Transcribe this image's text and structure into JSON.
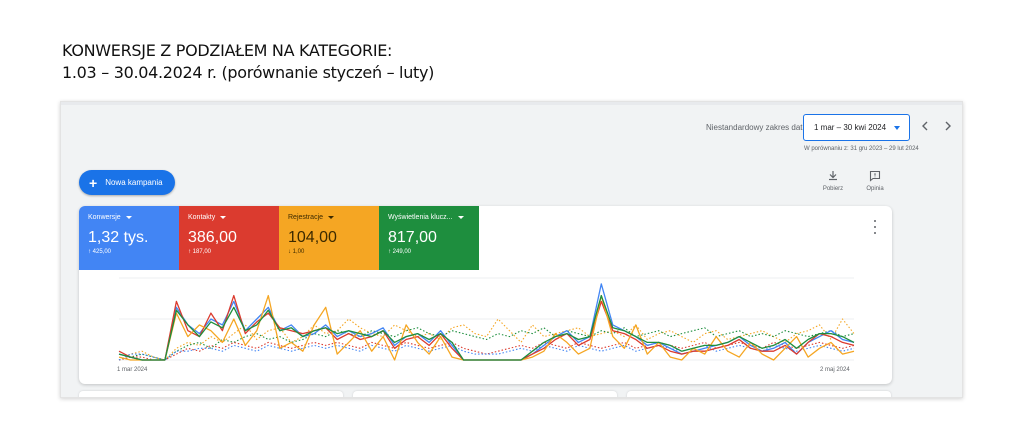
{
  "heading": {
    "line1": "KONWERSJE Z PODZIAŁEM NA KATEGORIE:",
    "line2": "1.03 – 30.04.2024 r. (porównanie styczeń – luty)"
  },
  "date_range": {
    "label": "Niestandardowy zakres dat",
    "value": "1 mar – 30 kwi 2024",
    "comparison": "W porównaniu z: 31 gru 2023 – 29 lut 2024",
    "prev_icon": "chevron-left-icon",
    "next_icon": "chevron-right-icon"
  },
  "toolbar": {
    "new_campaign": "Nowa kampania",
    "download": "Pobierz",
    "feedback": "Opinia"
  },
  "metrics": [
    {
      "label": "Konwersje",
      "value": "1,32 tys.",
      "change": "↑ 425,00",
      "color": "#4285f4"
    },
    {
      "label": "Kontakty",
      "value": "386,00",
      "change": "↑ 187,00",
      "color": "#db3b2f"
    },
    {
      "label": "Rejestracje",
      "value": "104,00",
      "change": "↓ 1,00",
      "color": "#f5a623"
    },
    {
      "label": "Wyświetlenia klucz...",
      "value": "817,00",
      "change": "↑ 249,00",
      "color": "#1e8e3e"
    }
  ],
  "chart_axis": {
    "start": "1 mar 2024",
    "end": "2 maj 2024"
  },
  "chart_data": {
    "type": "line",
    "series": [
      {
        "color": "#4285f4",
        "style": "solid",
        "values": [
          2,
          1,
          0,
          0,
          0,
          18,
          12,
          9,
          14,
          12,
          20,
          10,
          14,
          18,
          10,
          12,
          8,
          9,
          12,
          8,
          10,
          8,
          9,
          11,
          5,
          8,
          9,
          6,
          10,
          5,
          0,
          0,
          0,
          0,
          0,
          0,
          2,
          5,
          8,
          10,
          6,
          8,
          26,
          12,
          10,
          8,
          5,
          6,
          4,
          2,
          3,
          4,
          5,
          6,
          8,
          5,
          3,
          4,
          6,
          2,
          6,
          8,
          10,
          7,
          6
        ]
      },
      {
        "color": "#db3b2f",
        "style": "solid",
        "values": [
          3,
          1,
          0,
          0,
          0,
          20,
          10,
          8,
          16,
          10,
          22,
          9,
          13,
          16,
          11,
          10,
          9,
          10,
          11,
          7,
          9,
          7,
          8,
          10,
          4,
          7,
          8,
          5,
          9,
          4,
          0,
          0,
          0,
          0,
          0,
          0,
          2,
          4,
          7,
          9,
          5,
          7,
          20,
          10,
          9,
          7,
          4,
          5,
          3,
          2,
          3,
          3,
          4,
          5,
          7,
          4,
          3,
          3,
          5,
          2,
          6,
          9,
          8,
          6,
          5
        ]
      },
      {
        "color": "#f5a623",
        "style": "solid",
        "values": [
          1,
          0,
          0,
          0,
          0,
          16,
          8,
          12,
          10,
          6,
          14,
          5,
          10,
          22,
          4,
          6,
          3,
          12,
          18,
          2,
          6,
          10,
          3,
          8,
          0,
          12,
          6,
          2,
          8,
          1,
          0,
          0,
          0,
          0,
          0,
          0,
          1,
          3,
          9,
          6,
          2,
          4,
          22,
          8,
          4,
          12,
          2,
          6,
          1,
          0,
          4,
          2,
          8,
          3,
          1,
          6,
          2,
          0,
          4,
          8,
          1,
          4,
          6,
          2,
          3
        ]
      },
      {
        "color": "#1e8e3e",
        "style": "solid",
        "values": [
          2,
          1,
          0,
          0,
          0,
          17,
          12,
          8,
          13,
          11,
          18,
          10,
          12,
          17,
          10,
          11,
          8,
          10,
          11,
          9,
          10,
          9,
          8,
          10,
          6,
          8,
          9,
          7,
          9,
          6,
          0,
          0,
          0,
          0,
          0,
          0,
          3,
          6,
          8,
          9,
          7,
          8,
          22,
          11,
          10,
          8,
          6,
          6,
          5,
          3,
          4,
          5,
          5,
          6,
          8,
          6,
          4,
          5,
          7,
          4,
          7,
          9,
          9,
          8,
          6
        ]
      },
      {
        "color": "#f5a623",
        "style": "dotted",
        "values": [
          0,
          2,
          3,
          1,
          0,
          4,
          6,
          5,
          8,
          6,
          9,
          12,
          7,
          10,
          11,
          6,
          8,
          12,
          9,
          10,
          14,
          11,
          9,
          8,
          12,
          10,
          8,
          9,
          7,
          11,
          12,
          9,
          8,
          14,
          10,
          6,
          12,
          8,
          9,
          10,
          11,
          8,
          9,
          10,
          8,
          12,
          7,
          9,
          10,
          8,
          6,
          9,
          10,
          7,
          8,
          9,
          10,
          8,
          6,
          9,
          10,
          12,
          7,
          14,
          9
        ]
      },
      {
        "color": "#1e8e3e",
        "style": "dotted",
        "values": [
          0,
          1,
          2,
          1,
          0,
          3,
          5,
          6,
          4,
          7,
          6,
          8,
          9,
          7,
          8,
          6,
          7,
          9,
          8,
          10,
          9,
          8,
          10,
          9,
          8,
          10,
          11,
          9,
          8,
          10,
          9,
          8,
          7,
          9,
          8,
          10,
          9,
          11,
          8,
          10,
          9,
          8,
          10,
          9,
          11,
          8,
          9,
          10,
          8,
          9,
          10,
          11,
          8,
          9,
          10,
          8,
          9,
          8,
          10,
          9,
          8,
          9,
          10,
          8,
          9
        ]
      },
      {
        "color": "#db3b2f",
        "style": "dotted",
        "values": [
          0,
          1,
          1,
          0,
          0,
          2,
          4,
          3,
          5,
          4,
          6,
          5,
          4,
          6,
          5,
          4,
          5,
          6,
          5,
          6,
          5,
          4,
          6,
          5,
          4,
          6,
          5,
          4,
          5,
          6,
          4,
          3,
          2,
          3,
          4,
          5,
          4,
          6,
          5,
          4,
          6,
          5,
          4,
          5,
          6,
          4,
          5,
          6,
          5,
          4,
          5,
          6,
          4,
          5,
          6,
          5,
          4,
          6,
          5,
          4,
          5,
          6,
          5,
          4,
          5
        ]
      },
      {
        "color": "#4285f4",
        "style": "dotted",
        "values": [
          0,
          2,
          2,
          1,
          0,
          3,
          3,
          4,
          4,
          3,
          5,
          4,
          3,
          5,
          4,
          3,
          4,
          5,
          4,
          5,
          4,
          3,
          5,
          4,
          3,
          5,
          4,
          3,
          4,
          5,
          3,
          2,
          2,
          2,
          3,
          4,
          3,
          5,
          4,
          3,
          5,
          4,
          3,
          4,
          5,
          3,
          4,
          5,
          4,
          3,
          4,
          5,
          3,
          4,
          5,
          4,
          3,
          5,
          4,
          3,
          4,
          5,
          4,
          3,
          4
        ]
      }
    ],
    "x_range": [
      "1 mar 2024",
      "2 maj 2024"
    ],
    "ylim": [
      0,
      28
    ]
  }
}
